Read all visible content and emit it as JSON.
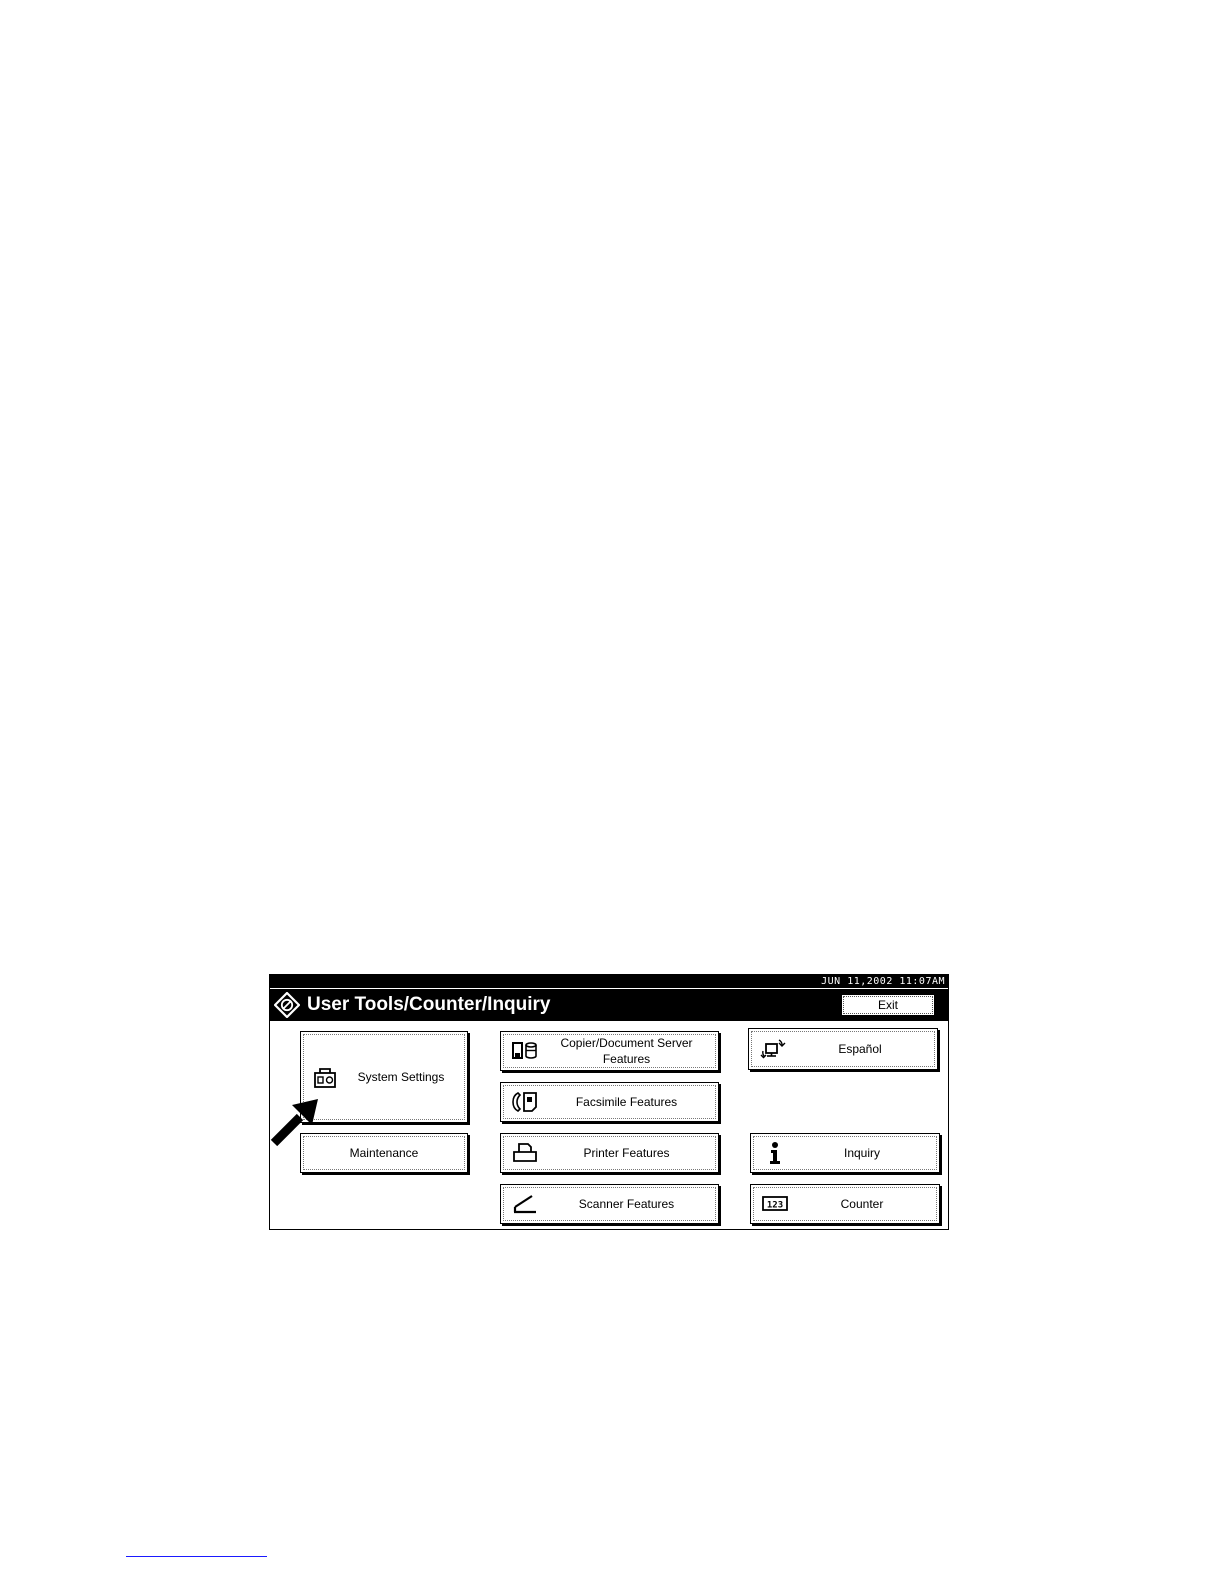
{
  "panel": {
    "datetime": "JUN  11,2002 11:07AM",
    "title": "User Tools/Counter/Inquiry",
    "exit_label": "Exit"
  },
  "buttons": {
    "system_settings": "System Settings",
    "maintenance": "Maintenance",
    "copier": "Copier/Document Server\nFeatures",
    "facsimile": "Facsimile Features",
    "printer": "Printer Features",
    "scanner": "Scanner Features",
    "espanol": "Español",
    "inquiry": "Inquiry",
    "counter": "Counter"
  },
  "icons": {
    "title": "user-tools-icon",
    "system_settings": "system-settings-icon",
    "copier": "copier-document-server-icon",
    "facsimile": "facsimile-icon",
    "printer": "printer-icon",
    "scanner": "scanner-icon",
    "espanol": "language-switch-icon",
    "inquiry": "info-icon",
    "counter": "counter-icon",
    "pointer": "pointer-arrow-icon"
  }
}
